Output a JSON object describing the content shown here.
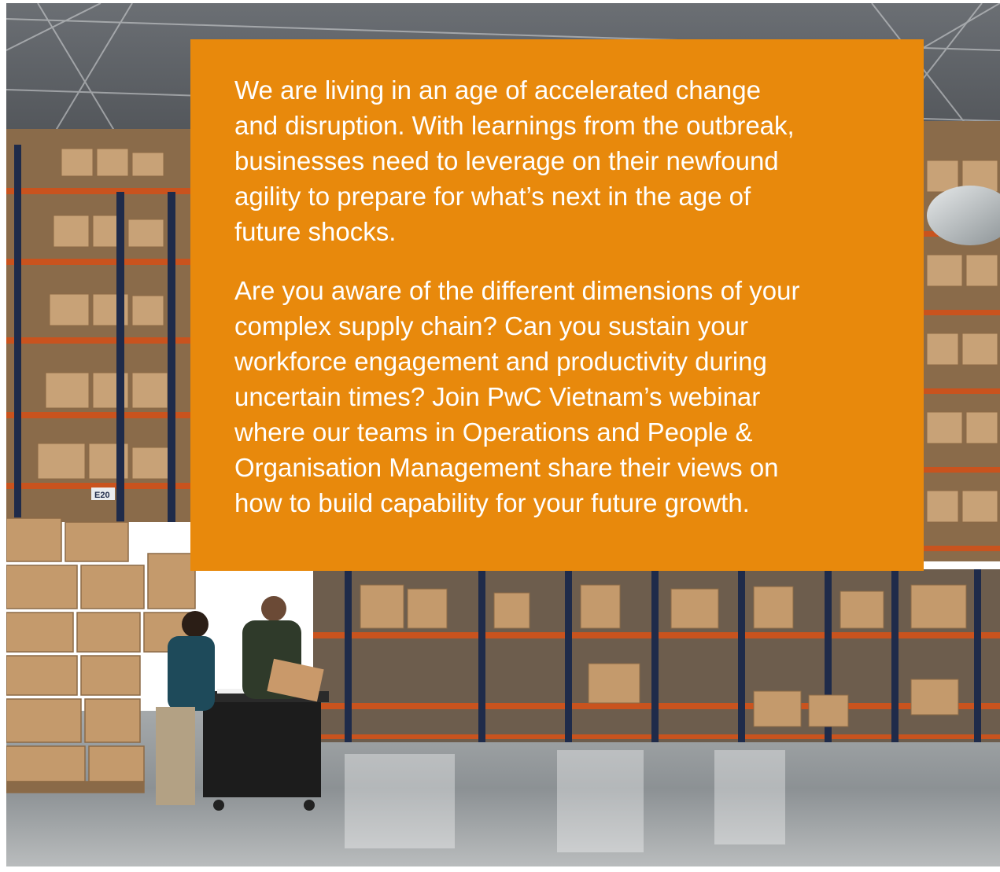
{
  "colors": {
    "panel": "#E8890C",
    "rack_orange": "#C9531E",
    "rack_navy": "#1F2B4A",
    "carton": "#C49A6C",
    "floor": "#8E9497",
    "ceiling": "#5A5E63"
  },
  "panel": {
    "paragraph_1": "We are living in an age of accelerated change\nand disruption. With learnings from the outbreak,\nbusinesses need to leverage on their newfound\nagility to prepare for what’s next in the age of\nfuture shocks.",
    "paragraph_2": "Are you aware of the different dimensions of your\ncomplex supply chain? Can you sustain your\nworkforce engagement and productivity during\nuncertain times? Join PwC Vietnam’s webinar\nwhere our teams in Operations and People &\nOrganisation Management share their views on\nhow to build capability for your future growth."
  },
  "scene": {
    "aisle_sign": "E20"
  }
}
